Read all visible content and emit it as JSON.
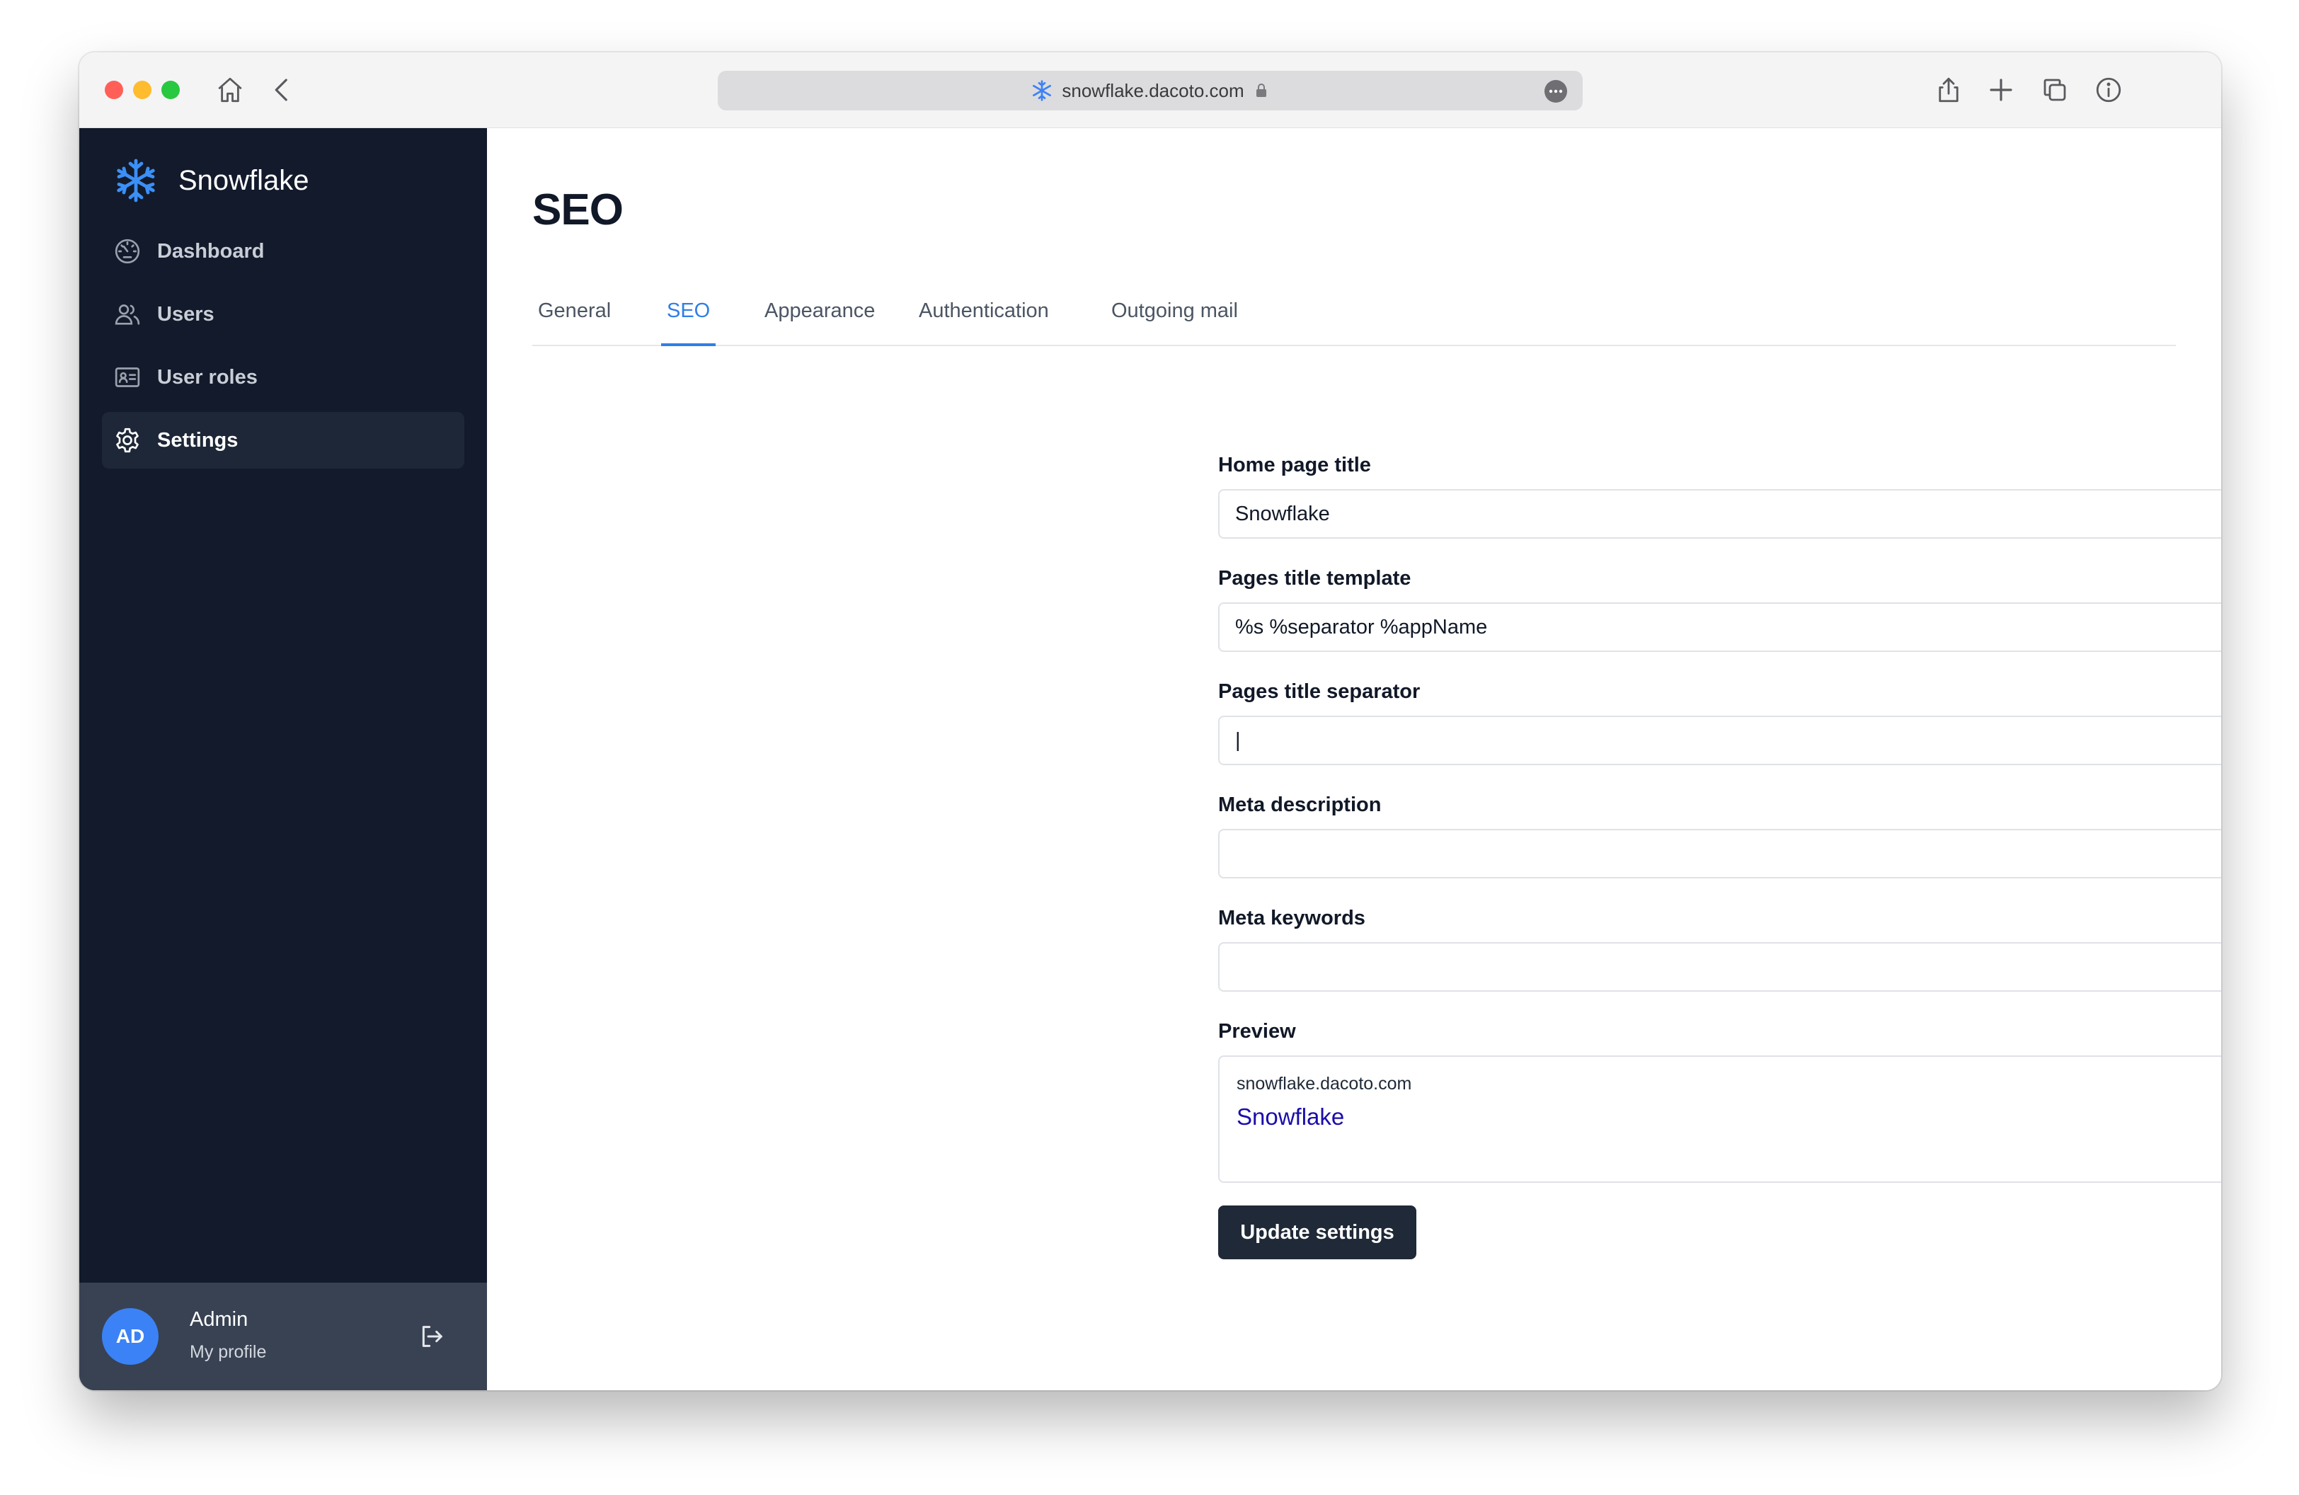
{
  "browser": {
    "url": "snowflake.dacoto.com",
    "colors": {
      "close": "#ff5f57",
      "minimize": "#febc2e",
      "maximize": "#28c840"
    }
  },
  "sidebar": {
    "brand": "Snowflake",
    "items": [
      {
        "label": "Dashboard",
        "icon": "dashboard-gauge-icon"
      },
      {
        "label": "Users",
        "icon": "users-icon"
      },
      {
        "label": "User roles",
        "icon": "id-card-icon"
      },
      {
        "label": "Settings",
        "icon": "gear-icon",
        "active": true
      }
    ],
    "profile": {
      "initials": "AD",
      "name": "Admin",
      "link": "My profile"
    }
  },
  "page": {
    "title": "SEO",
    "tabs": [
      {
        "label": "General"
      },
      {
        "label": "SEO",
        "active": true
      },
      {
        "label": "Appearance"
      },
      {
        "label": "Authentication"
      },
      {
        "label": "Outgoing mail"
      }
    ]
  },
  "form": {
    "home_title": {
      "label": "Home page title",
      "value": "Snowflake"
    },
    "title_template": {
      "label": "Pages title template",
      "value": "%s %separator %appName"
    },
    "title_separator": {
      "label": "Pages title separator",
      "value": "|"
    },
    "meta_description": {
      "label": "Meta description",
      "value": ""
    },
    "meta_keywords": {
      "label": "Meta keywords",
      "value": ""
    },
    "preview": {
      "label": "Preview",
      "url": "snowflake.dacoto.com",
      "title": "Snowflake"
    },
    "submit": "Update settings"
  },
  "theme": {
    "accent": "#2f7fe6",
    "sidebar_bg": "#121a2b",
    "avatar_bg": "#3b82f6",
    "link_color": "#1a0dab"
  }
}
